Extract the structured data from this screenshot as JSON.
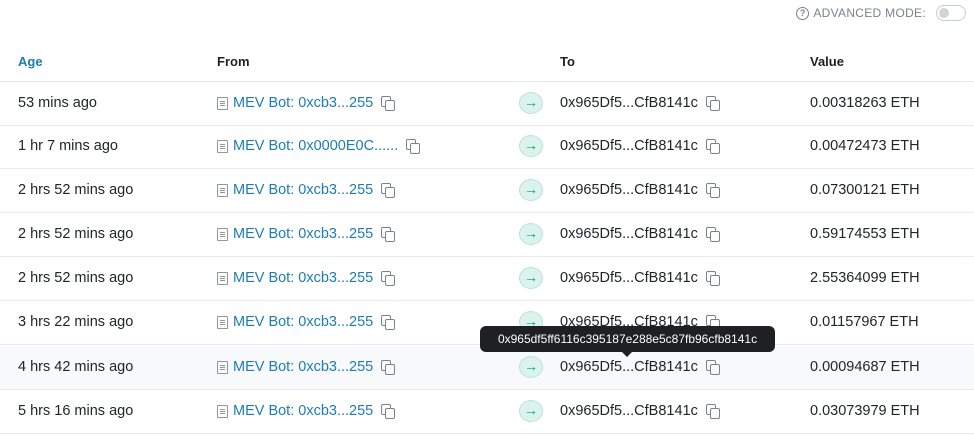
{
  "advanced_mode": {
    "label": "ADVANCED MODE:",
    "enabled": false
  },
  "columns": {
    "age": "Age",
    "from": "From",
    "to": "To",
    "value": "Value"
  },
  "rows": [
    {
      "age": "53 mins ago",
      "from": "MEV Bot: 0xcb3...255",
      "to": "0x965Df5...CfB8141c",
      "value": "0.00318263 ETH"
    },
    {
      "age": "1 hr 7 mins ago",
      "from": "MEV Bot: 0x0000E0C......",
      "to": "0x965Df5...CfB8141c",
      "value": "0.00472473 ETH"
    },
    {
      "age": "2 hrs 52 mins ago",
      "from": "MEV Bot: 0xcb3...255",
      "to": "0x965Df5...CfB8141c",
      "value": "0.07300121 ETH"
    },
    {
      "age": "2 hrs 52 mins ago",
      "from": "MEV Bot: 0xcb3...255",
      "to": "0x965Df5...CfB8141c",
      "value": "0.59174553 ETH"
    },
    {
      "age": "2 hrs 52 mins ago",
      "from": "MEV Bot: 0xcb3...255",
      "to": "0x965Df5...CfB8141c",
      "value": "2.55364099 ETH"
    },
    {
      "age": "3 hrs 22 mins ago",
      "from": "MEV Bot: 0xcb3...255",
      "to": "0x965Df5...CfB8141c",
      "value": "0.01157967 ETH"
    },
    {
      "age": "4 hrs 42 mins ago",
      "from": "MEV Bot: 0xcb3...255",
      "to": "0x965Df5...CfB8141c",
      "value": "0.00094687 ETH"
    },
    {
      "age": "5 hrs 16 mins ago",
      "from": "MEV Bot: 0xcb3...255",
      "to": "0x965Df5...CfB8141c",
      "value": "0.03073979 ETH"
    }
  ],
  "tooltip": {
    "text": "0x965df5ff6116c395187e288e5c87fb96cfb8141c"
  }
}
